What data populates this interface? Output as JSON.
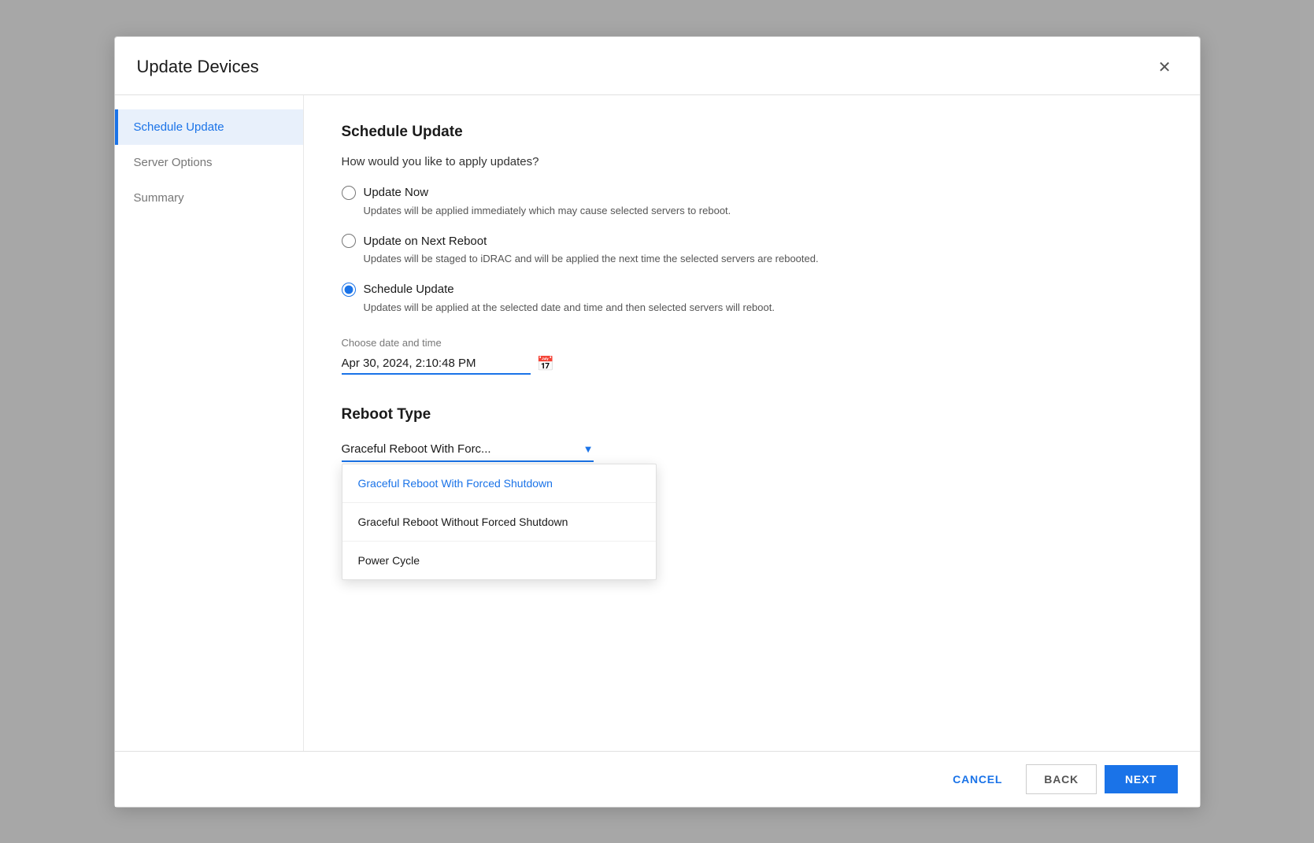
{
  "modal": {
    "title": "Update Devices",
    "close_label": "✕"
  },
  "sidebar": {
    "items": [
      {
        "id": "schedule-update",
        "label": "Schedule Update",
        "active": true
      },
      {
        "id": "server-options",
        "label": "Server Options",
        "active": false
      },
      {
        "id": "summary",
        "label": "Summary",
        "active": false
      }
    ]
  },
  "content": {
    "section_title": "Schedule Update",
    "question": "How would you like to apply updates?",
    "radio_options": [
      {
        "id": "update-now",
        "label": "Update Now",
        "description": "Updates will be applied immediately which may cause selected servers to reboot.",
        "checked": false
      },
      {
        "id": "update-on-next-reboot",
        "label": "Update on Next Reboot",
        "description": "Updates will be staged to iDRAC and will be applied the next time the selected servers are rebooted.",
        "checked": false
      },
      {
        "id": "schedule-update",
        "label": "Schedule Update",
        "description": "Updates will be applied at the selected date and time and then selected servers will reboot.",
        "checked": true
      }
    ],
    "date_section": {
      "label": "Choose date and time",
      "value": "Apr 30, 2024, 2:10:48 PM",
      "calendar_icon": "📅"
    },
    "reboot_section": {
      "title": "Reboot Type",
      "selected_label": "Graceful Reboot With Forc...",
      "dropdown_options": [
        {
          "label": "Graceful Reboot With Forced Shutdown",
          "selected": true
        },
        {
          "label": "Graceful Reboot Without Forced Shutdown",
          "selected": false
        },
        {
          "label": "Power Cycle",
          "selected": false
        }
      ]
    }
  },
  "footer": {
    "cancel_label": "CANCEL",
    "back_label": "BACK",
    "next_label": "NEXT"
  }
}
